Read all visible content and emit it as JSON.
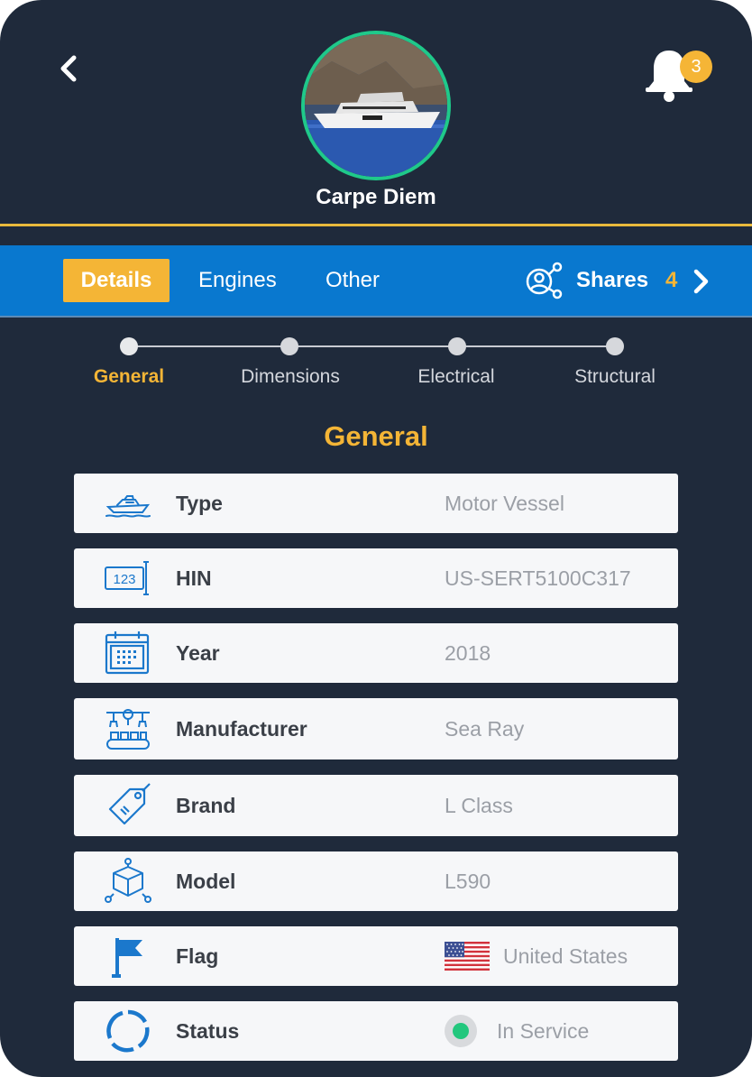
{
  "header": {
    "vessel_name": "Carpe Diem",
    "notification_count": "3"
  },
  "tabs": {
    "details": "Details",
    "engines": "Engines",
    "other": "Other",
    "shares_label": "Shares",
    "shares_count": "4"
  },
  "steps": [
    "General",
    "Dimensions",
    "Electrical",
    "Structural"
  ],
  "section_title": "General",
  "rows": [
    {
      "label": "Type",
      "value": "Motor Vessel",
      "icon": "yacht-icon"
    },
    {
      "label": "HIN",
      "value": "US-SERT5100C317",
      "icon": "hin-number-icon"
    },
    {
      "label": "Year",
      "value": "2018",
      "icon": "calendar-icon"
    },
    {
      "label": "Manufacturer",
      "value": "Sea Ray",
      "icon": "factory-icon"
    },
    {
      "label": "Brand",
      "value": "L Class",
      "icon": "tag-icon"
    },
    {
      "label": "Model",
      "value": "L590",
      "icon": "cube-model-icon"
    },
    {
      "label": "Flag",
      "value": "United States",
      "icon": "flag-icon"
    },
    {
      "label": "Status",
      "value": "In Service",
      "icon": "status-ring-icon"
    }
  ],
  "colors": {
    "background": "#1f2a3b",
    "tabbar": "#0978cf",
    "accent": "#f4b536",
    "avatar_ring": "#1fc98a",
    "status_green": "#22c77d",
    "icon_blue": "#1b78cc"
  }
}
